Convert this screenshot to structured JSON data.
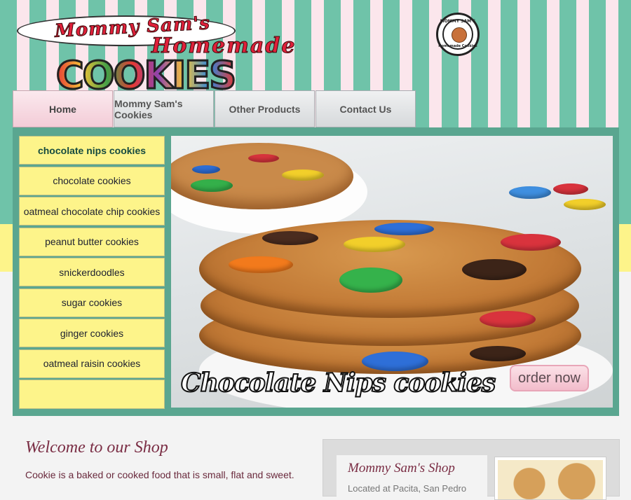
{
  "header": {
    "logo_line1": "Mommy Sam's",
    "logo_line2": "Homemade",
    "logo_line3": "COOKIES",
    "badge_top": "MOMMY SAM'S",
    "badge_bottom": "Homemade Cookies"
  },
  "nav": {
    "items": [
      {
        "label": "Home",
        "active": true
      },
      {
        "label": "Mommy Sam's Cookies"
      },
      {
        "label": "Other Products"
      },
      {
        "label": "Contact Us"
      }
    ]
  },
  "side_menu": {
    "items": [
      "chocolate nips cookies",
      "chocolate cookies",
      "oatmeal chocolate chip cookies",
      "peanut butter cookies",
      "snickerdoodles",
      "sugar cookies",
      "ginger cookies",
      "oatmeal raisin cookies"
    ]
  },
  "slider": {
    "caption": "Chocolate Nips cookies",
    "order_button": "order now"
  },
  "welcome": {
    "title": "Welcome to our Shop",
    "text": "Cookie is a baked or cooked food that is small, flat and sweet."
  },
  "shop": {
    "title": "Mommy Sam's Shop",
    "text": "Located at Pacita, San Pedro"
  },
  "colors": {
    "stripe_green": "#6fc3a9",
    "stripe_pink": "#fbe6ec",
    "menu_yellow": "#fdf48a",
    "frame_green": "#5aa690",
    "accent_maroon": "#7a2d44"
  }
}
